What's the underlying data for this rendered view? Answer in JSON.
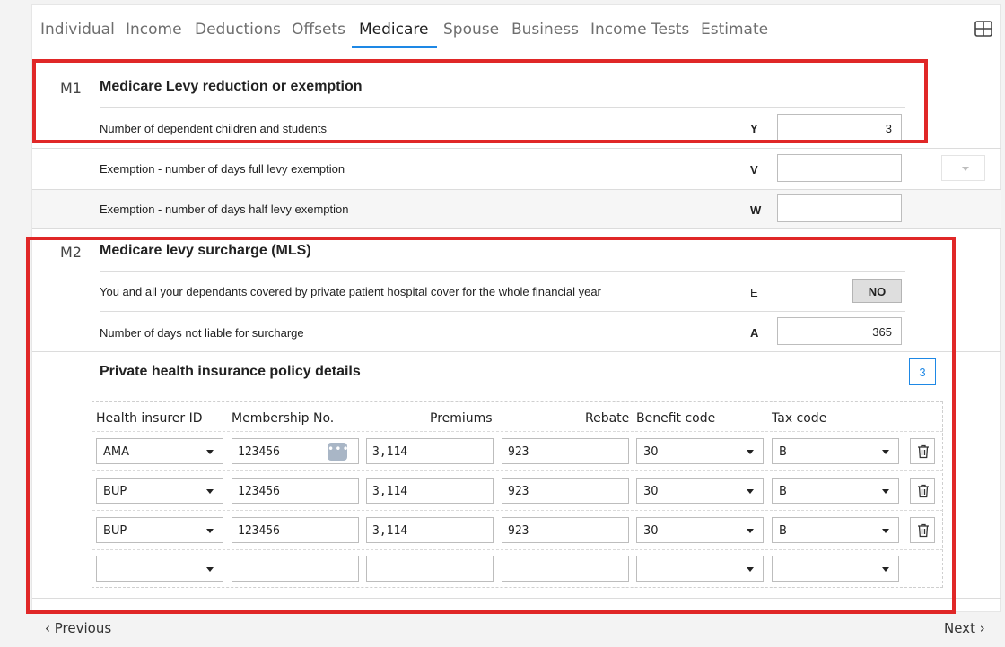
{
  "tabs": [
    {
      "label": "Individual"
    },
    {
      "label": "Income"
    },
    {
      "label": "Deductions"
    },
    {
      "label": "Offsets"
    },
    {
      "label": "Medicare"
    },
    {
      "label": "Spouse"
    },
    {
      "label": "Business"
    },
    {
      "label": "Income Tests"
    },
    {
      "label": "Estimate"
    }
  ],
  "active_tab": "Medicare",
  "m1": {
    "code": "M1",
    "title": "Medicare Levy reduction or exemption",
    "rows": [
      {
        "label": "Number of dependent children and students",
        "letter": "Y",
        "value": "3"
      },
      {
        "label": "Exemption - number of days full levy exemption",
        "letter": "V",
        "value": ""
      },
      {
        "label": "Exemption - number of days half levy exemption",
        "letter": "W",
        "value": ""
      }
    ]
  },
  "m2": {
    "code": "M2",
    "title": "Medicare levy surcharge (MLS)",
    "rows": [
      {
        "label": "You and all your dependants covered by private patient hospital cover for the whole financial year",
        "letter": "E",
        "value": "NO"
      },
      {
        "label": "Number of days not liable for surcharge",
        "letter": "A",
        "value": "365"
      }
    ]
  },
  "phi": {
    "title": "Private health insurance policy details",
    "count_badge": "3",
    "columns": {
      "insurer": "Health insurer ID",
      "membership": "Membership No.",
      "premiums": "Premiums",
      "rebate": "Rebate",
      "benefit": "Benefit code",
      "tax": "Tax code"
    },
    "rows": [
      {
        "insurer": "AMA",
        "membership": "123456",
        "premiums": "3,114",
        "rebate": "923",
        "benefit": "30",
        "tax": "B"
      },
      {
        "insurer": "BUP",
        "membership": "123456",
        "premiums": "3,114",
        "rebate": "923",
        "benefit": "30",
        "tax": "B"
      },
      {
        "insurer": "BUP",
        "membership": "123456",
        "premiums": "3,114",
        "rebate": "923",
        "benefit": "30",
        "tax": "B"
      },
      {
        "insurer": "",
        "membership": "",
        "premiums": "",
        "rebate": "",
        "benefit": "",
        "tax": ""
      }
    ]
  },
  "footer": {
    "previous": "‹ Previous",
    "next": "Next ›"
  },
  "colors": {
    "accent": "#1e88e5",
    "highlight_box": "#e02727"
  }
}
